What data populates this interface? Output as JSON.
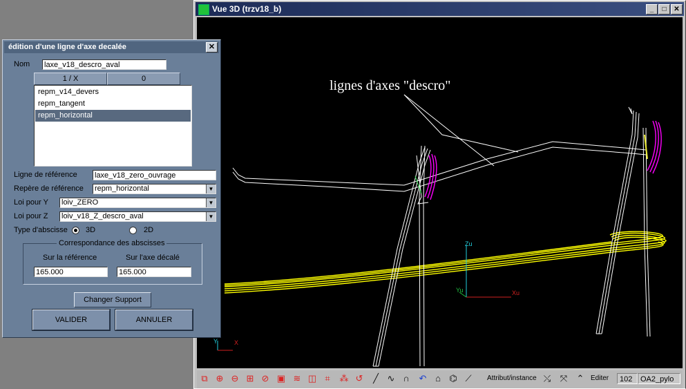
{
  "window3d": {
    "title": "Vue 3D (trzv18_b)",
    "controls": {
      "minimize": "_",
      "maximize": "□",
      "close": "✕"
    },
    "annotation": "lignes d'axes \"descro\"",
    "axes": {
      "z": "Zu",
      "y": "Yu",
      "x": "Xu",
      "small_y": "Y",
      "small_x": "X"
    },
    "toolbar": {
      "attribut_label": "Attribut/instance",
      "editer_label": "Editer",
      "layer_number": "102",
      "layer_name": "OA2_pylo"
    }
  },
  "dialog": {
    "title": "édition d'une ligne d'axe decalée",
    "close": "✕",
    "nom_label": "Nom",
    "nom_value": "laxe_v18_descro_aval",
    "col1": "1 / X",
    "col2": "0",
    "list_items": [
      "repm_v14_devers",
      "repm_tangent",
      "repm_horizontal"
    ],
    "ligne_ref_label": "Ligne de référence",
    "ligne_ref_value": "laxe_v18_zero_ouvrage",
    "repere_label": "Repère de référence",
    "repere_value": "repm_horizontal",
    "loi_y_label": "Loi pour Y",
    "loi_y_value": "loiv_ZERO",
    "loi_z_label": "Loi pour Z",
    "loi_z_value": "loiv_v18_Z_descro_aval",
    "type_abscisse_label": "Type d'abscisse",
    "opt_3d": "3D",
    "opt_2d": "2D",
    "group_title": "Correspondance des abscisses",
    "sur_ref_label": "Sur la référence",
    "sur_axe_label": "Sur l'axe décalé",
    "sur_ref_value": "165.000",
    "sur_axe_value": "165.000",
    "changer_support": "Changer Support",
    "valider": "VALIDER",
    "annuler": "ANNULER"
  },
  "colors": {
    "viewport_bg": "#000000",
    "axis_line": "#ffffff",
    "highlight": "#ff00ff",
    "yellow": "#ffff00",
    "dialog_bg": "#6a7f99",
    "selection": "#58697f"
  }
}
